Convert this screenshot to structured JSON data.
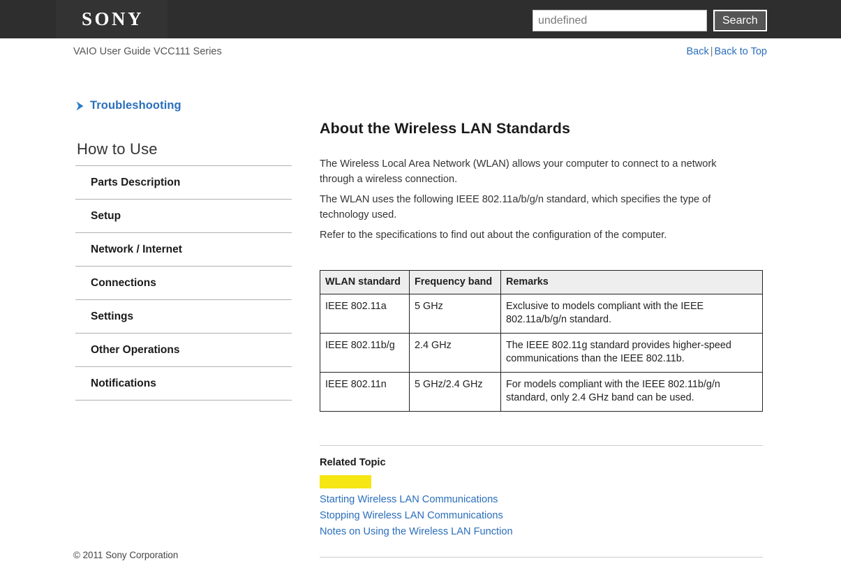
{
  "header": {
    "logo_text": "SONY",
    "logo_icon": "sony-logo",
    "search": {
      "value": "undefined",
      "placeholder": "undefined",
      "button_label": "Search"
    }
  },
  "subheader": {
    "guide_title": "VAIO User Guide VCC111 Series",
    "back_label": "Back",
    "separator": "|",
    "back_to_top_label": "Back to Top"
  },
  "sidebar": {
    "troubleshooting": {
      "label": "Troubleshooting",
      "icon": "chevron-right-icon"
    },
    "section_heading": "How to Use",
    "items": [
      {
        "label": "Parts Description"
      },
      {
        "label": "Setup"
      },
      {
        "label": "Network / Internet"
      },
      {
        "label": "Connections"
      },
      {
        "label": "Settings"
      },
      {
        "label": "Other Operations"
      },
      {
        "label": "Notifications"
      }
    ]
  },
  "main": {
    "title": "About the Wireless LAN Standards",
    "paragraphs": [
      "The Wireless Local Area Network (WLAN) allows your computer to connect to a network through a wireless connection.",
      "The WLAN uses the following IEEE 802.11a/b/g/n standard, which specifies the type of technology used.",
      "Refer to the specifications to find out about the configuration of the computer."
    ],
    "table": {
      "headers": [
        "WLAN standard",
        "Frequency band",
        "Remarks"
      ],
      "rows": [
        {
          "standard": "IEEE 802.11a",
          "band": "5 GHz",
          "remarks": "Exclusive to models compliant with the IEEE 802.11a/b/g/n standard."
        },
        {
          "standard": "IEEE 802.11b/g",
          "band": "2.4 GHz",
          "remarks": "The IEEE 802.11g standard provides higher-speed communications than the IEEE 802.11b."
        },
        {
          "standard": "IEEE 802.11n",
          "band": "5 GHz/2.4 GHz",
          "remarks": "For models compliant with the IEEE 802.11b/g/n standard, only 2.4 GHz band can be used."
        }
      ]
    },
    "related": {
      "title": "Related Topic",
      "highlight_color": "#f5e614",
      "links": [
        "Starting Wireless LAN Communications",
        "Stopping Wireless LAN Communications",
        "Notes on Using the Wireless LAN Function"
      ]
    }
  },
  "footer": {
    "copyright": "© 2011 Sony Corporation"
  }
}
